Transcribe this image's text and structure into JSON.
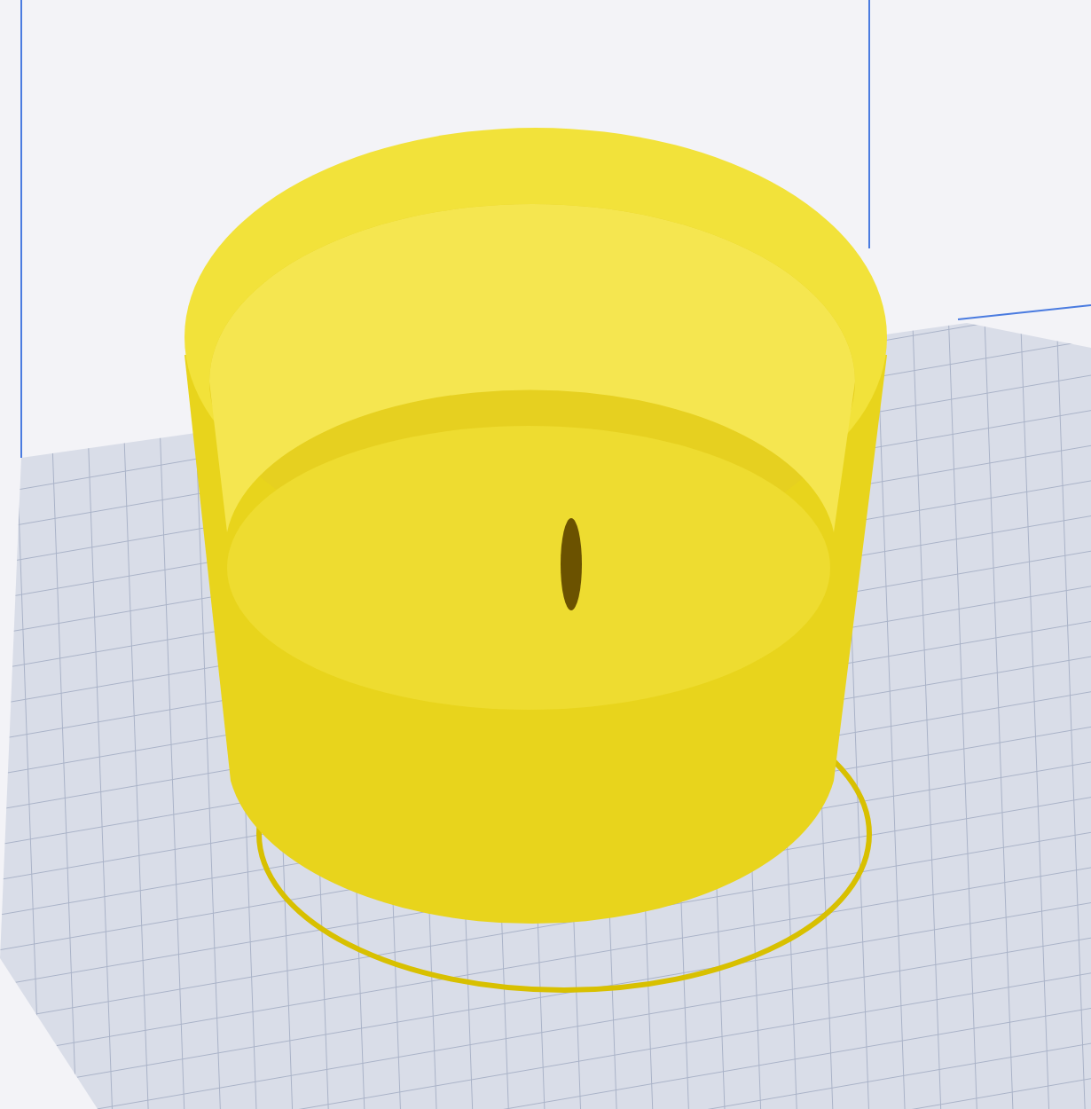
{
  "viewport": {
    "kind": "cylinder"
  }
}
